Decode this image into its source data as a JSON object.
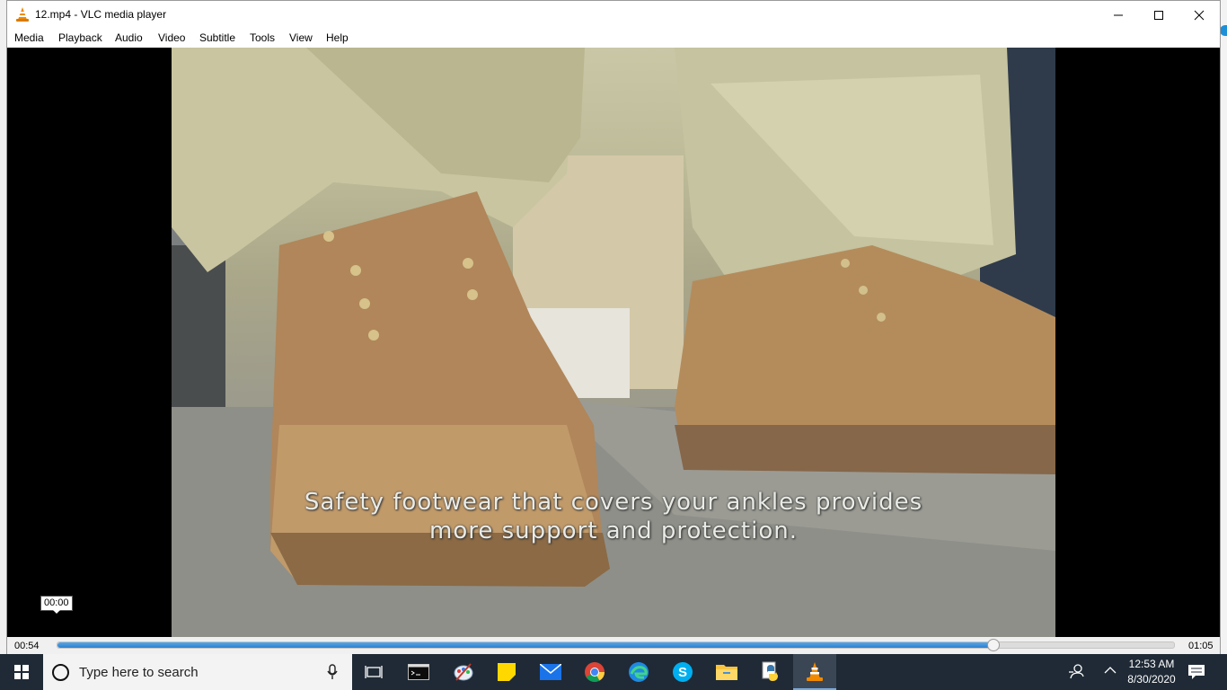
{
  "window": {
    "title": "12.mp4 - VLC media player",
    "icon": "vlc-cone-icon"
  },
  "menu": [
    {
      "label": "Media"
    },
    {
      "label": "Playback"
    },
    {
      "label": "Audio"
    },
    {
      "label": "Video"
    },
    {
      "label": "Subtitle"
    },
    {
      "label": "Tools"
    },
    {
      "label": "View"
    },
    {
      "label": "Help"
    }
  ],
  "video": {
    "subtitle_line1": "Safety footwear that covers your ankles provides",
    "subtitle_line2": "more support and protection.",
    "hover_time": "00:00"
  },
  "player": {
    "elapsed": "00:54",
    "total": "01:05",
    "progress": 0.838
  },
  "taskbar": {
    "search_placeholder": "Type here to search",
    "clock_time": "12:53 AM",
    "clock_date": "8/30/2020",
    "icons": [
      "task-view-icon",
      "terminal-icon",
      "paint-icon",
      "sticky-notes-icon",
      "mail-icon",
      "chrome-icon",
      "edge-icon",
      "skype-icon",
      "file-explorer-icon",
      "python-icon",
      "vlc-icon"
    ]
  },
  "colors": {
    "progress_fill": "#2d7fce",
    "taskbar_bg": "#1f2a36",
    "vlc_orange": "#f08a00"
  }
}
